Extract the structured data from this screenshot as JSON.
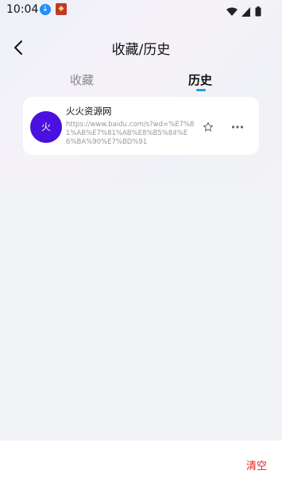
{
  "status_bar": {
    "time": "10:04",
    "icons": [
      "download-icon",
      "app-icon",
      "wifi-icon",
      "signal-icon",
      "battery-icon"
    ]
  },
  "header": {
    "title": "收藏/历史",
    "back_icon": "chevron-left-icon"
  },
  "tabs": [
    {
      "label": "收藏",
      "active": false
    },
    {
      "label": "历史",
      "active": true
    }
  ],
  "history_items": [
    {
      "avatar_text": "火",
      "avatar_color": "#4a10e0",
      "title": "火火资源网",
      "url": "https://www.baidu.com/s?wd=%E7%81%AB%E7%81%AB%E8%B5%84%E6%BA%90%E7%BD%91",
      "icons": [
        "star-icon",
        "more-icon"
      ]
    }
  ],
  "footer": {
    "clear_label": "清空"
  },
  "colors": {
    "accent": "#1aa1e6",
    "danger": "#e02020",
    "background": "#f2f3f6"
  }
}
